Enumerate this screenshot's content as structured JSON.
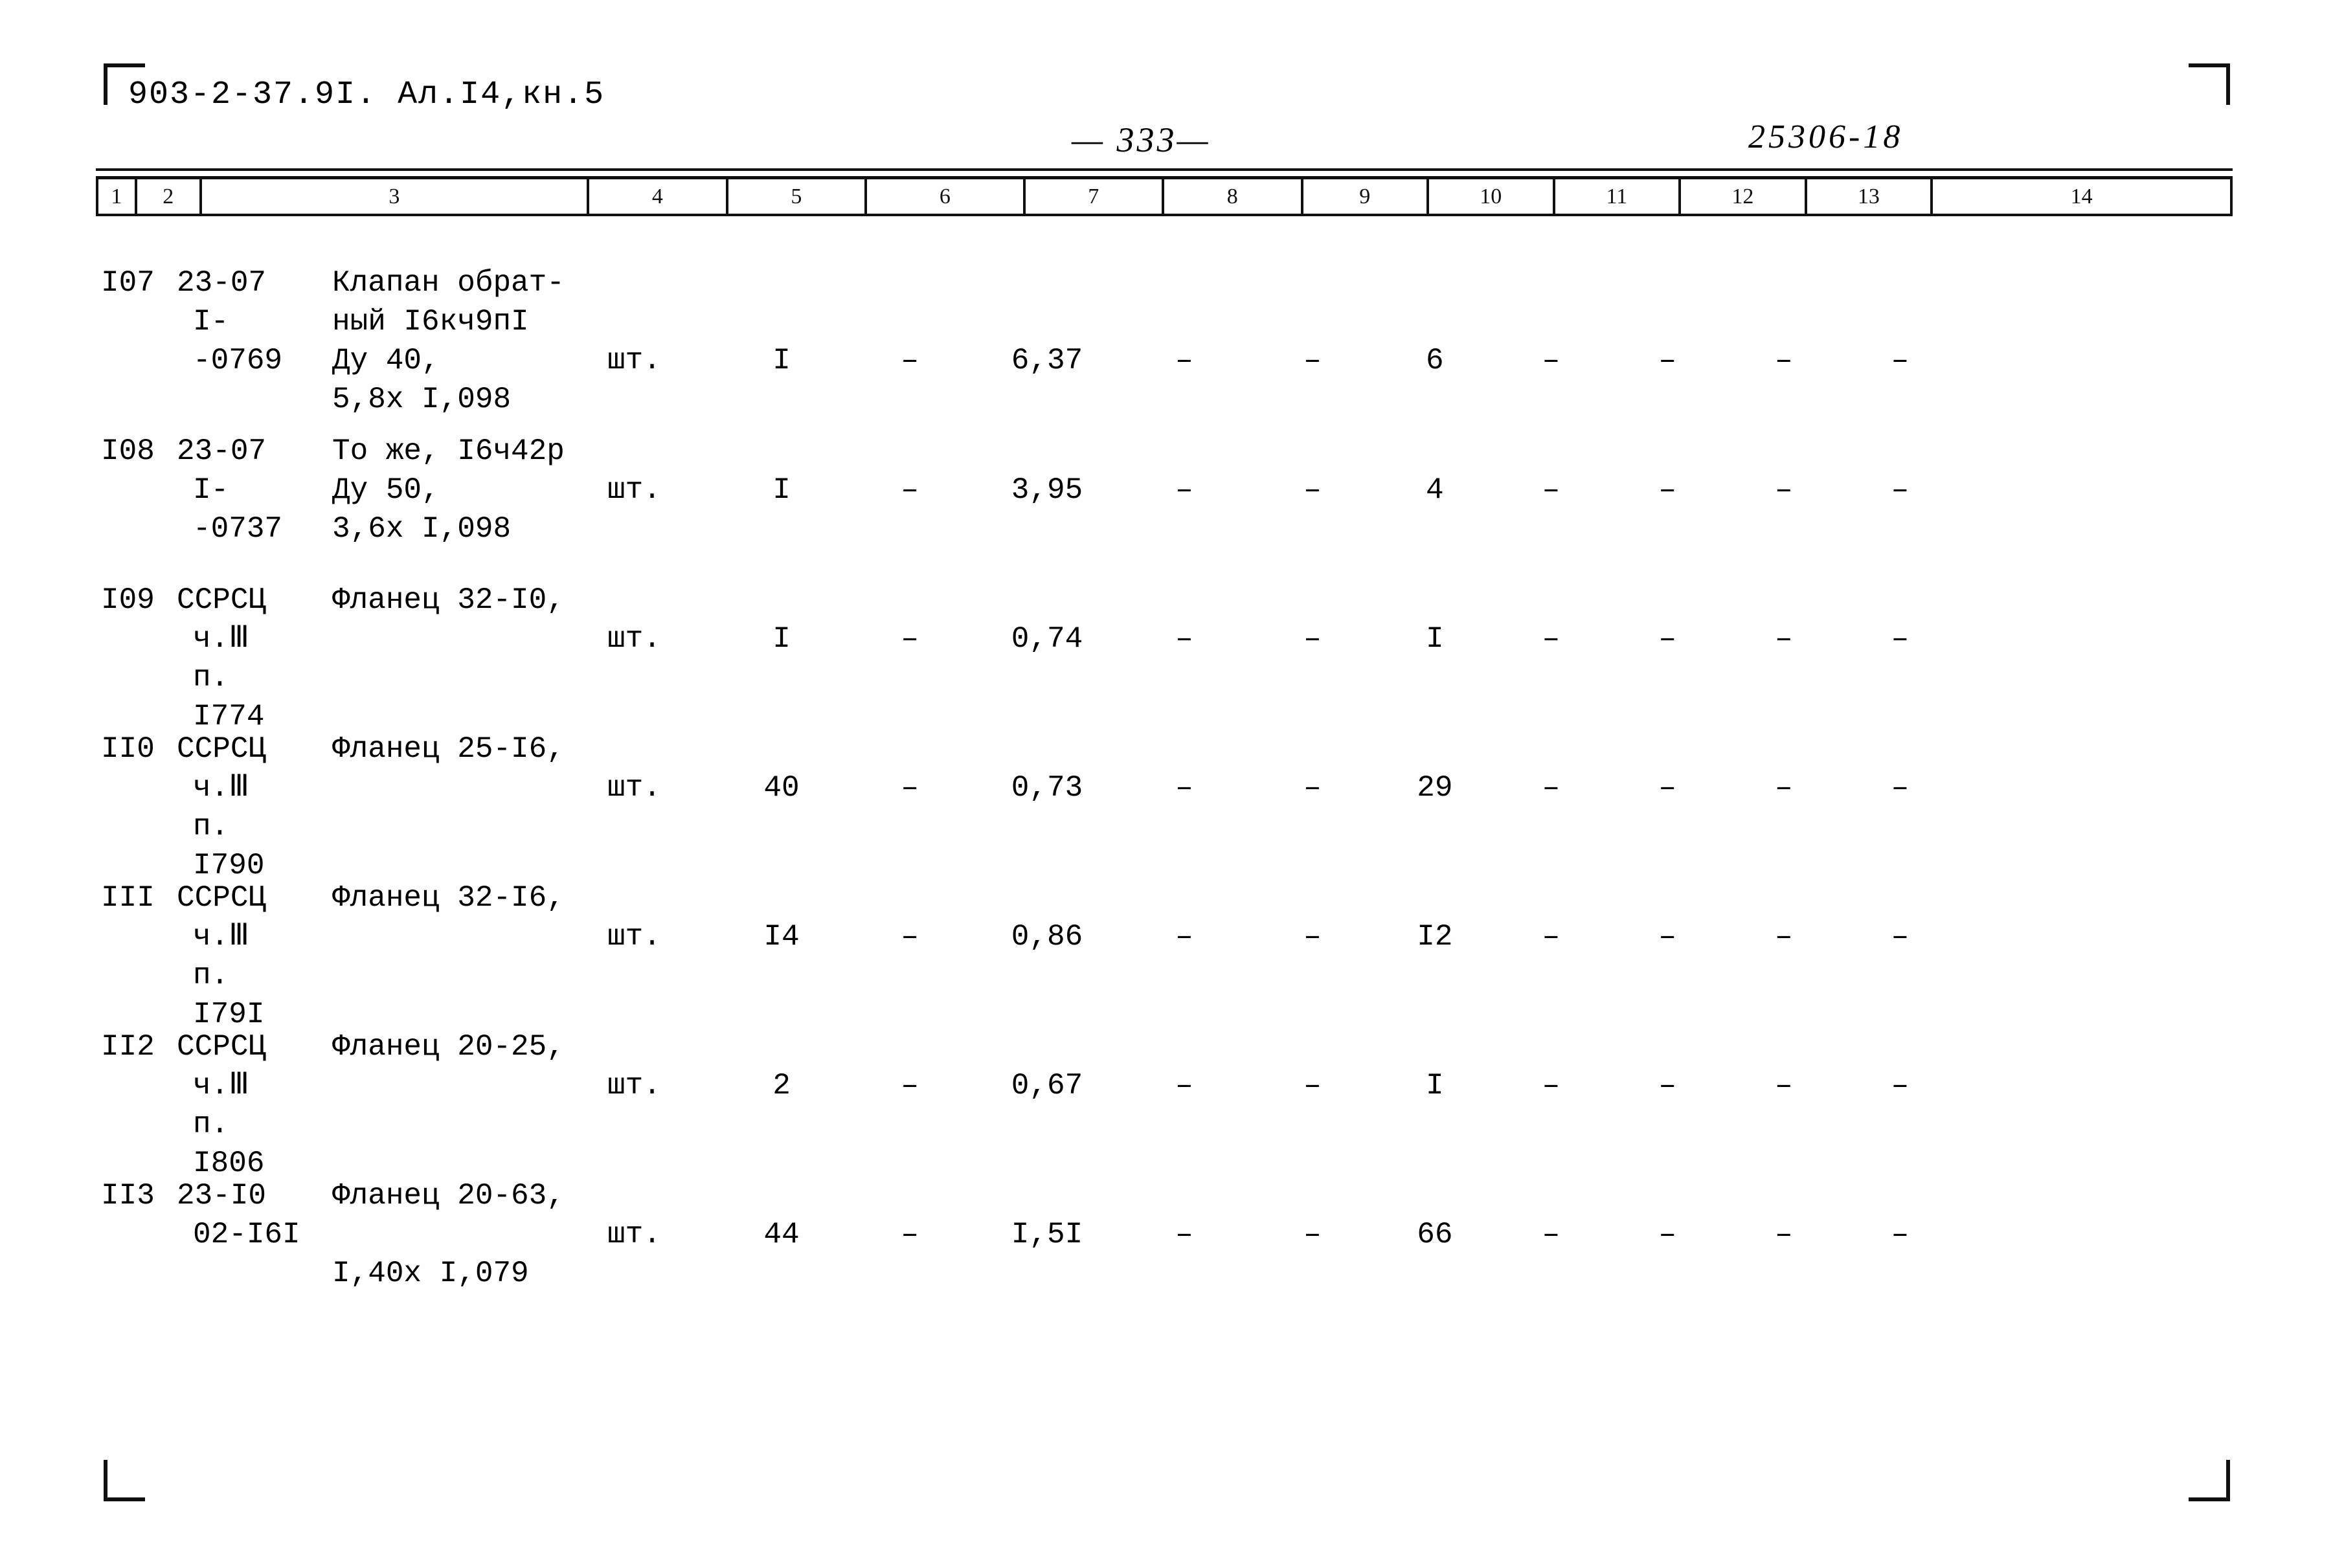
{
  "header": {
    "doc_code": "903-2-37.9I.  Ал.I4,кн.5",
    "page_number": "— 333—",
    "stamp_code": "25306-18"
  },
  "table": {
    "column_headers": [
      "1",
      "2",
      "3",
      "4",
      "5",
      "6",
      "7",
      "8",
      "9",
      "10",
      "11",
      "12",
      "13",
      "14"
    ],
    "rows": [
      {
        "pos": "I07",
        "code_lines": [
          "23-07",
          "I-",
          "-0769",
          ""
        ],
        "name_lines": [
          "Клапан обрат-",
          "ный I6кч9пI",
          "Ду 40,",
          "5,8х I,098"
        ],
        "unit": "шт.",
        "unit_line": 2,
        "value_line": 2,
        "c4": "I",
        "c5": "–",
        "c6": "6,37",
        "c7": "–",
        "c8": "–",
        "c9": "6",
        "c10": "–",
        "c11": "–",
        "c12": "–",
        "c13": "–",
        "c14": ""
      },
      {
        "pos": "I08",
        "code_lines": [
          "23-07",
          "I-",
          "-0737",
          ""
        ],
        "name_lines": [
          "То же, I6ч42р",
          "Ду 50,",
          "3,6х I,098"
        ],
        "unit": "шт.",
        "unit_line": 1,
        "value_line": 1,
        "c4": "I",
        "c5": "–",
        "c6": "3,95",
        "c7": "–",
        "c8": "–",
        "c9": "4",
        "c10": "–",
        "c11": "–",
        "c12": "–",
        "c13": "–",
        "c14": ""
      },
      {
        "pos": "I09",
        "code_lines": [
          "ССРСЦ",
          "ч.Ⅲ",
          "п.",
          "I774"
        ],
        "name_lines": [
          "Фланец 32-I0,",
          "",
          ""
        ],
        "unit": "шт.",
        "unit_line": 1,
        "value_line": 1,
        "c4": "I",
        "c5": "–",
        "c6": "0,74",
        "c7": "–",
        "c8": "–",
        "c9": "I",
        "c10": "–",
        "c11": "–",
        "c12": "–",
        "c13": "–",
        "c14": ""
      },
      {
        "pos": "II0",
        "code_lines": [
          "ССРСЦ",
          "ч.Ⅲ",
          "п.",
          "I790"
        ],
        "name_lines": [
          "Фланец 25-I6,",
          "",
          ""
        ],
        "unit": "шт.",
        "unit_line": 1,
        "value_line": 1,
        "c4": "40",
        "c5": "–",
        "c6": "0,73",
        "c7": "–",
        "c8": "–",
        "c9": "29",
        "c10": "–",
        "c11": "–",
        "c12": "–",
        "c13": "–",
        "c14": ""
      },
      {
        "pos": "III",
        "code_lines": [
          "ССРСЦ",
          "ч.Ⅲ",
          "п.",
          "I79I"
        ],
        "name_lines": [
          "Фланец 32-I6,",
          "",
          ""
        ],
        "unit": "шт.",
        "unit_line": 1,
        "value_line": 1,
        "c4": "I4",
        "c5": "–",
        "c6": "0,86",
        "c7": "–",
        "c8": "–",
        "c9": "I2",
        "c10": "–",
        "c11": "–",
        "c12": "–",
        "c13": "–",
        "c14": ""
      },
      {
        "pos": "II2",
        "code_lines": [
          "ССРСЦ",
          "ч.Ⅲ",
          "п.",
          "I806"
        ],
        "name_lines": [
          "Фланец 20-25,",
          "",
          ""
        ],
        "unit": "шт.",
        "unit_line": 1,
        "value_line": 1,
        "c4": "2",
        "c5": "–",
        "c6": "0,67",
        "c7": "–",
        "c8": "–",
        "c9": "I",
        "c10": "–",
        "c11": "–",
        "c12": "–",
        "c13": "–",
        "c14": ""
      },
      {
        "pos": "II3",
        "code_lines": [
          "23-I0",
          "02-I6I",
          "",
          ""
        ],
        "name_lines": [
          "Фланец 20-63,",
          "",
          "I,40х I,079"
        ],
        "unit": "шт.",
        "unit_line": 1,
        "value_line": 1,
        "c4": "44",
        "c5": "–",
        "c6": "I,5I",
        "c7": "–",
        "c8": "–",
        "c9": "66",
        "c10": "–",
        "c11": "–",
        "c12": "–",
        "c13": "–",
        "c14": ""
      }
    ]
  }
}
